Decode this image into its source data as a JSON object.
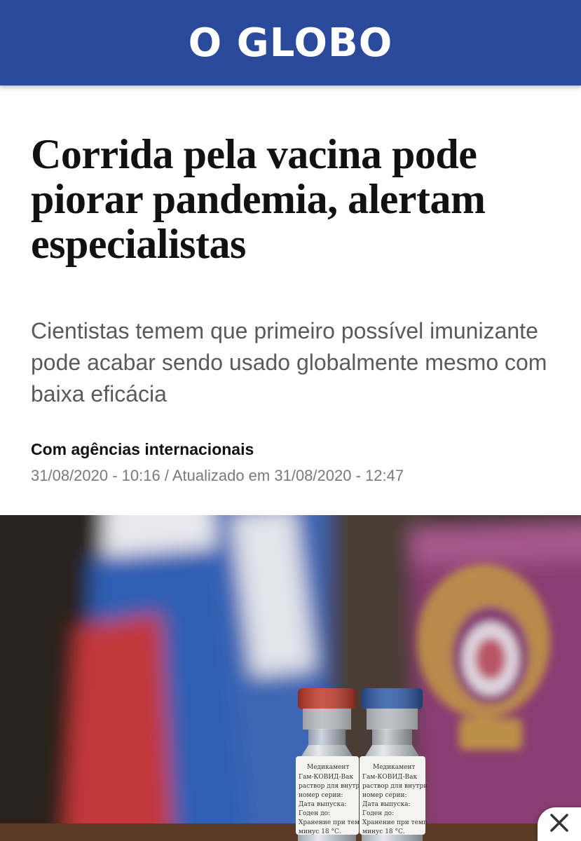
{
  "header": {
    "logo": "O GLOBO",
    "background_color": "#2c4a9b"
  },
  "article": {
    "headline": "Corrida pela vacina pode piorar pandemia, alertam especialistas",
    "subtitle": "Cientistas temem que primeiro possível imunizante pode acabar sendo usado globalmente mesmo com baixa eficácia",
    "byline": "Com agências internacionais",
    "dateline": "31/08/2020 - 10:16 / Atualizado em 31/08/2020 - 12:47"
  },
  "photo": {
    "vial_left_cap_color": "#c0392b",
    "vial_right_cap_color": "#2e5aa8"
  },
  "close_button": {
    "icon": "close-icon"
  }
}
